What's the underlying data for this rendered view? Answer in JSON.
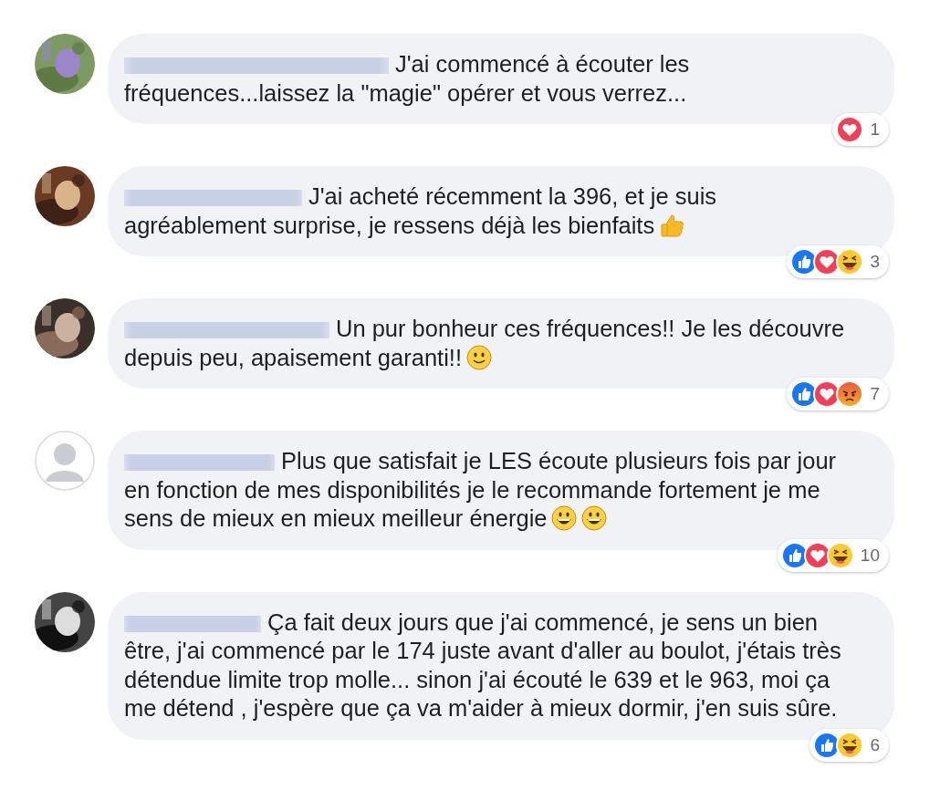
{
  "comments": [
    {
      "avatar": {
        "kind": "picture"
      },
      "text": "J'ai commencé à écouter les fréquences...laissez la \"magie\" opérer et vous verrez...",
      "reactions": [
        {
          "kind": "love"
        }
      ],
      "reaction_count": "1"
    },
    {
      "avatar": {
        "kind": "picture"
      },
      "text": "J'ai acheté récemment la 396, et je suis agréablement surprise, je ressens déjà les bienfaits",
      "emoji": [
        {
          "kind": "thumbs_up"
        }
      ],
      "reactions": [
        {
          "kind": "like"
        },
        {
          "kind": "love"
        },
        {
          "kind": "haha"
        }
      ],
      "reaction_count": "3"
    },
    {
      "avatar": {
        "kind": "picture"
      },
      "text": "Un pur bonheur ces fréquences!! Je les découvre depuis peu, apaisement garanti!!",
      "emoji": [
        {
          "kind": "smile"
        }
      ],
      "reactions": [
        {
          "kind": "like"
        },
        {
          "kind": "love"
        },
        {
          "kind": "angry"
        }
      ],
      "reaction_count": "7"
    },
    {
      "avatar": {
        "kind": "default"
      },
      "text": "Plus que satisfait je LES écoute plusieurs fois par jour en fonction de mes disponibilités je le recommande fortement je me sens de mieux en mieux meilleur énergie",
      "emoji": [
        {
          "kind": "grin"
        },
        {
          "kind": "grin"
        }
      ],
      "reactions": [
        {
          "kind": "like"
        },
        {
          "kind": "love"
        },
        {
          "kind": "haha"
        }
      ],
      "reaction_count": "10"
    },
    {
      "avatar": {
        "kind": "picture"
      },
      "text": "Ça fait deux jours que j'ai commencé, je sens un bien être, j'ai commencé par le 174 juste avant d'aller au boulot, j'étais très détendue limite trop molle... sinon j'ai écouté le 639 et le 963, moi ça me détend , j'espère que ça va m'aider à mieux dormir, j'en suis sûre.",
      "reactions": [
        {
          "kind": "like"
        },
        {
          "kind": "haha"
        }
      ],
      "reaction_count": "6"
    }
  ]
}
